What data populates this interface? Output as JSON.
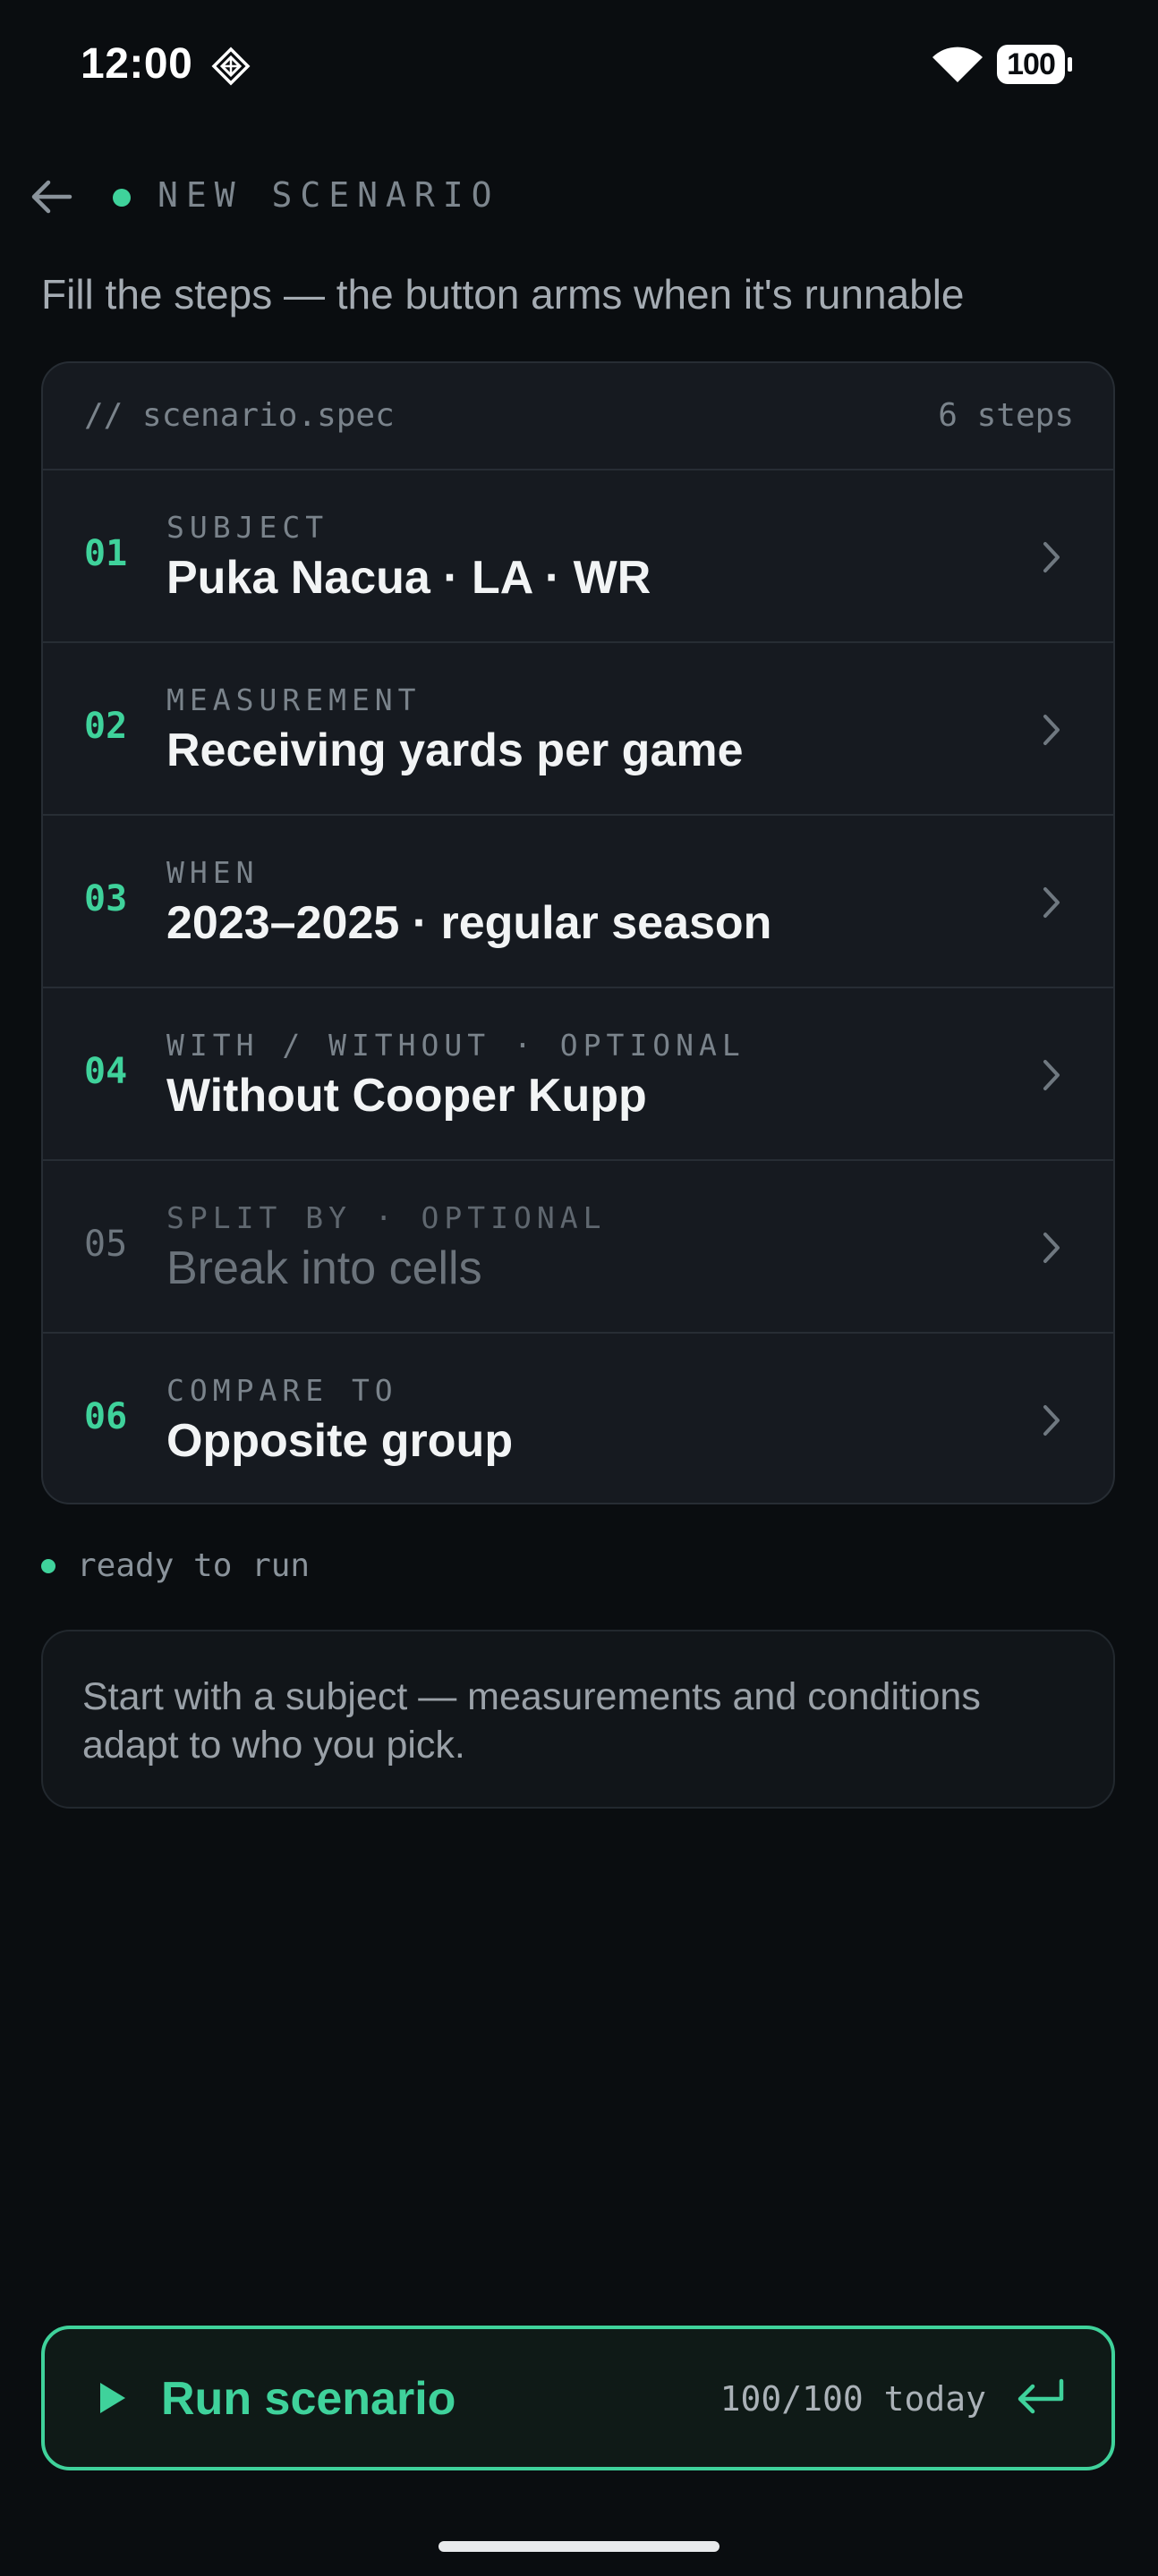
{
  "status_bar": {
    "time": "12:00",
    "battery": "100"
  },
  "header": {
    "title": "NEW SCENARIO"
  },
  "subtitle": "Fill the steps — the button arms when it's runnable",
  "spec": {
    "file": "// scenario.spec",
    "count": "6 steps",
    "steps": [
      {
        "num": "01",
        "label": "SUBJECT",
        "value": "Puka Nacua · LA · WR",
        "filled": true
      },
      {
        "num": "02",
        "label": "MEASUREMENT",
        "value": "Receiving yards per game",
        "filled": true
      },
      {
        "num": "03",
        "label": "WHEN",
        "value": "2023–2025 · regular season",
        "filled": true
      },
      {
        "num": "04",
        "label": "WITH / WITHOUT · OPTIONAL",
        "value": "Without Cooper Kupp",
        "filled": true
      },
      {
        "num": "05",
        "label": "SPLIT BY · OPTIONAL",
        "value": "Break into cells",
        "filled": false
      },
      {
        "num": "06",
        "label": "COMPARE TO",
        "value": "Opposite group",
        "filled": true
      }
    ]
  },
  "status": {
    "text": "ready to run"
  },
  "hint": {
    "text": "Start with a subject — measurements and conditions adapt to who you pick."
  },
  "run": {
    "label": "Run scenario",
    "quota": "100/100 today"
  },
  "colors": {
    "accent": "#3fd29b",
    "background": "#0a0d10",
    "card": "#161a20"
  },
  "icons": {
    "back": "back-arrow-icon",
    "status": "diamond-icon",
    "wifi": "wifi-icon",
    "chevron": "chevron-right-icon",
    "play": "play-icon",
    "enter": "enter-icon"
  }
}
